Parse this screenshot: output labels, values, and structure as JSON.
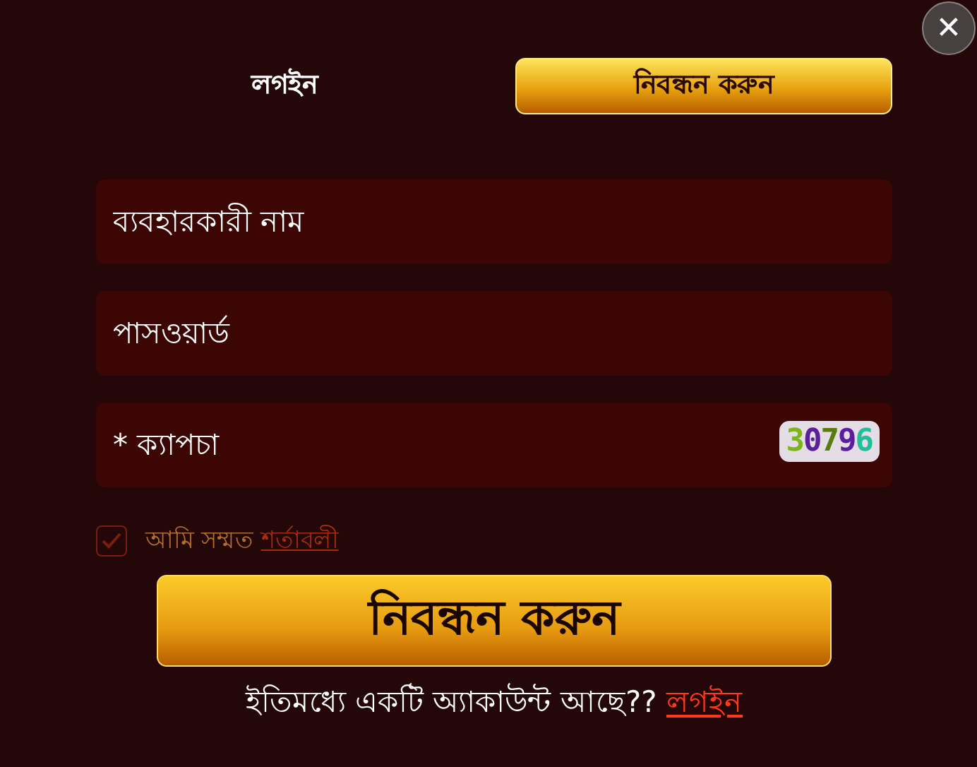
{
  "close_button": {
    "label": "✕"
  },
  "tabs": [
    {
      "label": "লগইন",
      "selected": false
    },
    {
      "label": "নিবন্ধন করুন",
      "selected": true
    }
  ],
  "fields": [
    {
      "placeholder": "ব্যবহারকারী নাম"
    },
    {
      "placeholder": "পাসওয়ার্ড"
    },
    {
      "placeholder": "* ক্যাপচা",
      "kind": "captcha"
    }
  ],
  "captcha": {
    "digits": [
      {
        "char": "3",
        "color": "#7cb518"
      },
      {
        "char": "0",
        "color": "#5b1f9e"
      },
      {
        "char": "7",
        "color": "#5a7a12"
      },
      {
        "char": "9",
        "color": "#5b1f9e"
      },
      {
        "char": "6",
        "color": "#1fbf9a"
      }
    ]
  },
  "agreement": {
    "checked": true,
    "text": "আমি সম্মত",
    "link": "শর্তাবলী"
  },
  "submit_button": {
    "label": "নিবন্ধন করুন"
  },
  "footer": {
    "text": "ইতিমধ্যে একটি অ্যাকাউন্ট আছে??",
    "link": "লগইন"
  }
}
